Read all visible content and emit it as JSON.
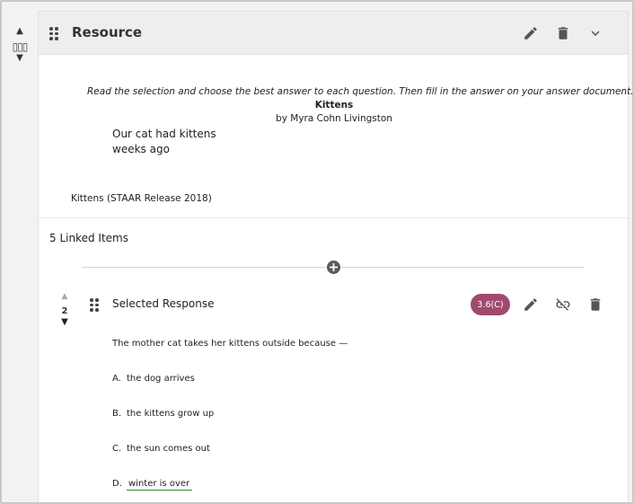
{
  "resource": {
    "title": "Resource",
    "order": {
      "up": "▲",
      "handle": "▯▯▯",
      "down": "▼"
    }
  },
  "passage": {
    "instructions": "Read the selection and choose the best answer to each question. Then fill in the answer on your answer document.",
    "title": "Kittens",
    "author": "by Myra Cohn Livingston",
    "lines": [
      "Our cat had kittens",
      "weeks ago"
    ],
    "source": "Kittens (STAAR Release 2018)"
  },
  "linked_items": {
    "label": "5 Linked Items"
  },
  "item": {
    "order": {
      "up": "▲",
      "number": "2",
      "down": "▼"
    },
    "type": "Selected Response",
    "standard": "3.6(C)",
    "question": "The mother cat takes her kittens outside because —",
    "options": [
      {
        "letter": "A.",
        "text": "the dog arrives",
        "correct": false
      },
      {
        "letter": "B.",
        "text": "the kittens grow up",
        "correct": false
      },
      {
        "letter": "C.",
        "text": "the sun comes out",
        "correct": false
      },
      {
        "letter": "D.",
        "text": "winter is over",
        "correct": true
      }
    ]
  },
  "icons": {
    "edit": "pencil-icon",
    "delete": "trash-icon",
    "collapse": "chevron-down-icon",
    "unlink": "unlink-icon",
    "add": "plus-circle-icon",
    "drag": "drag-handle-icon"
  },
  "colors": {
    "badge": "#a0496f",
    "header_bg": "#eeeeee",
    "correct_underline": "#2e8b2e"
  }
}
